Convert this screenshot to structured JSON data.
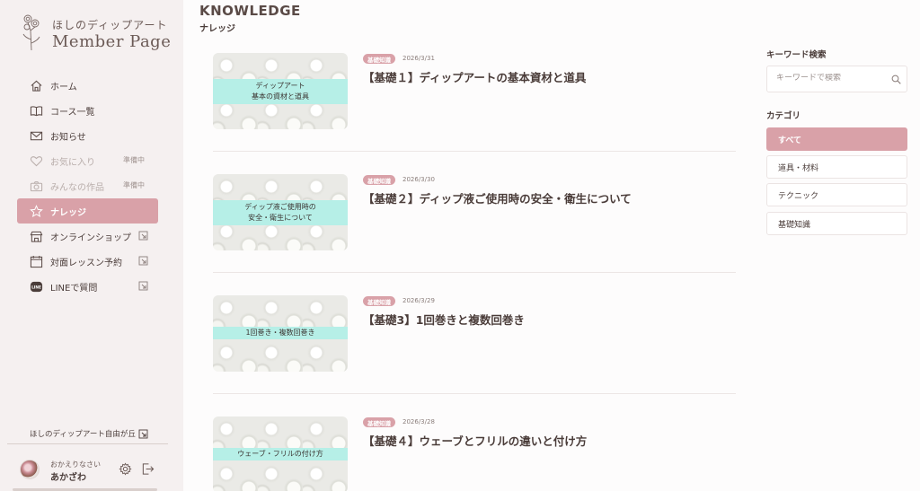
{
  "brand": {
    "sub": "ほしのディップアート",
    "main": "Member Page"
  },
  "nav": [
    {
      "label": "ホーム"
    },
    {
      "label": "コース一覧"
    },
    {
      "label": "お知らせ"
    },
    {
      "label": "お気に入り",
      "badge": "準備中"
    },
    {
      "label": "みんなの作品",
      "badge": "準備中"
    },
    {
      "label": "ナレッジ"
    },
    {
      "label": "オンラインショップ"
    },
    {
      "label": "対面レッスン予約"
    },
    {
      "label": "LINEで質問"
    }
  ],
  "footer": {
    "link": "ほしのディップアート自由が丘"
  },
  "user": {
    "greeting": "おかえりなさい",
    "name": "あかざわ"
  },
  "page": {
    "title": "KNOWLEDGE",
    "subtitle": "ナレッジ"
  },
  "articles": [
    {
      "thumb_line1": "ディップアート",
      "thumb_line2": "基本の資材と道具",
      "tag": "基礎知識",
      "date": "2026/3/31",
      "title": "【基礎１】ディップアートの基本資材と道具"
    },
    {
      "thumb_line1": "ディップ液ご使用時の",
      "thumb_line2": "安全・衛生について",
      "tag": "基礎知識",
      "date": "2026/3/30",
      "title": "【基礎２】ディップ液ご使用時の安全・衛生について"
    },
    {
      "thumb_line1": "1回巻き・複数回巻き",
      "thumb_line2": "",
      "tag": "基礎知識",
      "date": "2026/3/29",
      "title": "【基礎3】1回巻きと複数回巻き"
    },
    {
      "thumb_line1": "ウェーブ・フリルの付け方",
      "thumb_line2": "",
      "tag": "基礎知識",
      "date": "2026/3/28",
      "title": "【基礎４】ウェーブとフリルの違いと付け方"
    }
  ],
  "search": {
    "label": "キーワード検索",
    "placeholder": "キーワードで検索"
  },
  "categories": {
    "label": "カテゴリ",
    "items": [
      "すべて",
      "道具・材料",
      "テクニック",
      "基礎知識"
    ]
  },
  "colors": {
    "accent": "#d9a1a8",
    "thumb_band": "#b6efe7",
    "sidebar_bg": "#f5f0f0"
  }
}
